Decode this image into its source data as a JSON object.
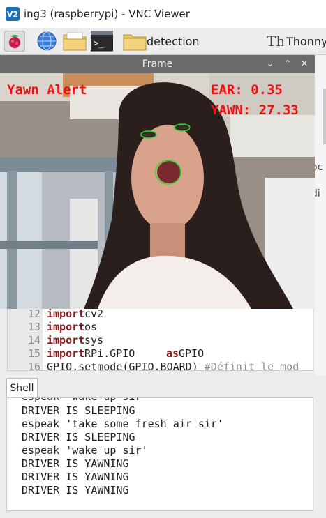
{
  "vnc": {
    "logo": "V2",
    "title": "ing3 (raspberrypi) - VNC Viewer"
  },
  "taskbar": {
    "items": [
      {
        "icon": "raspberry-menu-icon"
      },
      {
        "icon": "web-browser-icon"
      },
      {
        "icon": "file-manager-icon"
      },
      {
        "icon": "terminal-icon",
        "label": ">_"
      },
      {
        "icon": "folder-icon",
        "label": "detection"
      },
      {
        "icon": "thonny-icon",
        "label": "Thonny"
      }
    ]
  },
  "frame": {
    "title": "Frame",
    "buttons": {
      "minimize": "⌄",
      "maximize": "⌃",
      "close": "✕"
    },
    "overlay": {
      "alert": "Yawn Alert",
      "ear": "EAR: 0.35",
      "yawn": "YAWN: 27.33"
    }
  },
  "right_partial": {
    "top": "oc",
    "bottom": "di"
  },
  "editor": {
    "lines": [
      {
        "num": "12",
        "kw": "import",
        "rest": " cv2"
      },
      {
        "num": "13",
        "kw": "import",
        "rest": " os"
      },
      {
        "num": "14",
        "kw": "import",
        "rest": " sys"
      },
      {
        "num": "15",
        "kw": "import",
        "rest": " RPi.GPIO ",
        "kw2": "as",
        "rest2": " GPIO"
      },
      {
        "num": "16",
        "code": "GPIO.setmode(GPIO.BOARD) ",
        "comment": "#Définit le mod"
      }
    ]
  },
  "shell": {
    "tab": "Shell",
    "lines": [
      "espeak 'wake up sir'",
      "DRIVER IS SLEEPING",
      "espeak 'take some fresh air sir'",
      "DRIVER IS SLEEPING",
      "espeak 'wake up sir'",
      "DRIVER IS YAWNING",
      "DRIVER IS YAWNING",
      "DRIVER IS YAWNING"
    ]
  },
  "colors": {
    "alert": "#ee1111",
    "landmark": "#22dd33",
    "keyword": "#8b1a1a"
  }
}
